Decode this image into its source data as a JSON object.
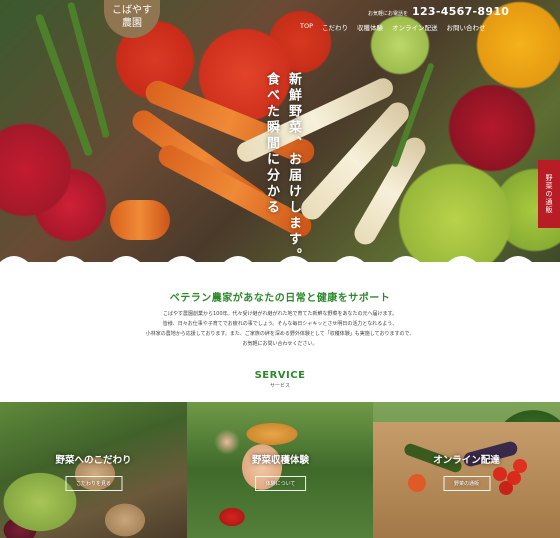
{
  "logo": {
    "line1": "こばやす",
    "line2": "農園"
  },
  "nav": {
    "items": [
      "TOP",
      "こだわり",
      "収穫体験",
      "オンライン配送",
      "お問い合わせ"
    ]
  },
  "tel": {
    "label": "お気軽にお電話を",
    "number": "123-4567-8910"
  },
  "hero": {
    "copy_line1": "食べた瞬間に分かる",
    "copy_line2": "新鮮野菜、お届けします。"
  },
  "side_tab": {
    "label": "野菜の通販"
  },
  "intro": {
    "headline": "ベテラン農家があなたの日常と健康をサポート",
    "lines": [
      "こばやす農園創業から100年。代々受け継がれ継がれた地で育てた新鮮な野菜をあなたの元へ届けます。",
      "皆様、日々お仕事や子育てでお疲れの事でしょう。そんな毎日シャキッとさせ明日の活力となれるよう、",
      "小林家の農地から応援しております。また、ご家族の絆を深める野外体験として「収穫体験」も実施しておりますので、",
      "お気軽にお問い合わせください。"
    ]
  },
  "service": {
    "title": "SERVICE",
    "subtitle": "サービス",
    "cards": [
      {
        "caption": "野菜へのこだわり",
        "button": "こだわりを見る"
      },
      {
        "caption": "野菜収穫体験",
        "button": "体験について"
      },
      {
        "caption": "オンライン配達",
        "button": "野菜の通販"
      }
    ]
  }
}
